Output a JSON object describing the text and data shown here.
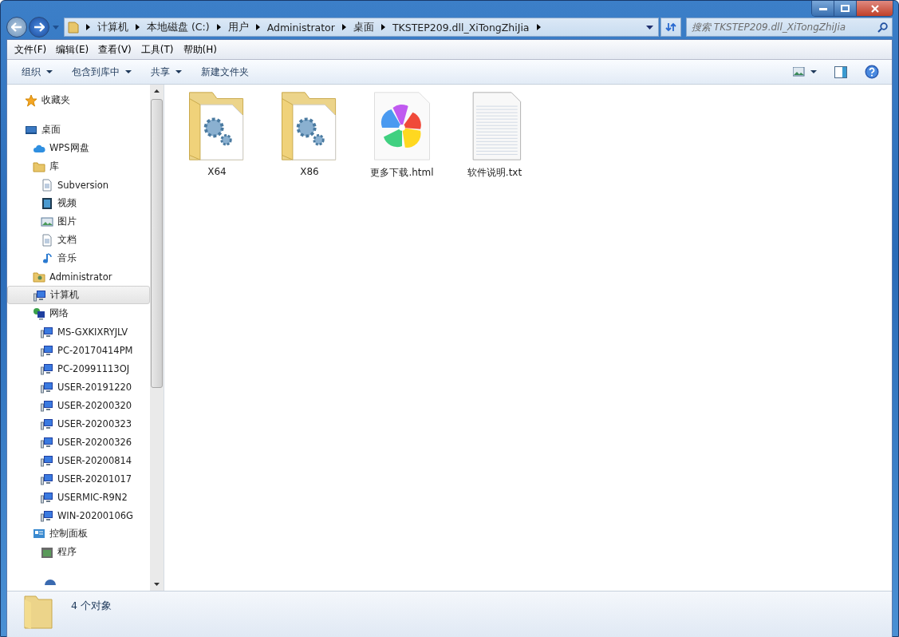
{
  "address_bar": {
    "segments": [
      "计算机",
      "本地磁盘 (C:)",
      "用户",
      "Administrator",
      "桌面",
      "TKSTEP209.dll_XiTongZhiJia"
    ]
  },
  "search": {
    "placeholder": "搜索 TKSTEP209.dll_XiTongZhiJia"
  },
  "menu": [
    "文件(F)",
    "编辑(E)",
    "查看(V)",
    "工具(T)",
    "帮助(H)"
  ],
  "toolbar": [
    {
      "label": "组织",
      "dropdown": true
    },
    {
      "label": "包含到库中",
      "dropdown": true
    },
    {
      "label": "共享",
      "dropdown": true
    },
    {
      "label": "新建文件夹",
      "dropdown": false
    }
  ],
  "sidebar": {
    "groups": [
      {
        "items": [
          {
            "label": "收藏夹",
            "kind": "star",
            "selected": false
          }
        ]
      },
      {
        "items": [
          {
            "label": "桌面",
            "kind": "desktop",
            "selected": false,
            "children": [
              {
                "label": "WPS网盘",
                "kind": "cloud",
                "selected": false
              },
              {
                "label": "库",
                "kind": "library",
                "selected": false,
                "children": [
                  {
                    "label": "Subversion",
                    "kind": "svn",
                    "selected": false
                  },
                  {
                    "label": "视频",
                    "kind": "video",
                    "selected": false
                  },
                  {
                    "label": "图片",
                    "kind": "picture",
                    "selected": false
                  },
                  {
                    "label": "文档",
                    "kind": "document",
                    "selected": false
                  },
                  {
                    "label": "音乐",
                    "kind": "music",
                    "selected": false
                  }
                ]
              },
              {
                "label": "Administrator",
                "kind": "user",
                "selected": false
              },
              {
                "label": "计算机",
                "kind": "computer",
                "selected": true
              },
              {
                "label": "网络",
                "kind": "network",
                "selected": false,
                "children": [
                  {
                    "label": "MS-GXKIXRYJLV",
                    "kind": "computer",
                    "selected": false
                  },
                  {
                    "label": "PC-20170414PM",
                    "kind": "computer",
                    "selected": false
                  },
                  {
                    "label": "PC-20991113OJ",
                    "kind": "computer",
                    "selected": false
                  },
                  {
                    "label": "USER-20191220",
                    "kind": "computer",
                    "selected": false
                  },
                  {
                    "label": "USER-20200320",
                    "kind": "computer",
                    "selected": false
                  },
                  {
                    "label": "USER-20200323",
                    "kind": "computer",
                    "selected": false
                  },
                  {
                    "label": "USER-20200326",
                    "kind": "computer",
                    "selected": false
                  },
                  {
                    "label": "USER-20200814",
                    "kind": "computer",
                    "selected": false
                  },
                  {
                    "label": "USER-20201017",
                    "kind": "computer",
                    "selected": false
                  },
                  {
                    "label": "USERMIC-R9N2",
                    "kind": "computer",
                    "selected": false
                  },
                  {
                    "label": "WIN-20200106G",
                    "kind": "computer",
                    "selected": false
                  }
                ]
              },
              {
                "label": "控制面板",
                "kind": "control-panel",
                "selected": false,
                "children": [
                  {
                    "label": "程序",
                    "kind": "program",
                    "selected": false
                  }
                ]
              }
            ]
          }
        ]
      }
    ]
  },
  "files": [
    {
      "name": "X64",
      "kind": "folder"
    },
    {
      "name": "X86",
      "kind": "folder"
    },
    {
      "name": "更多下载.html",
      "kind": "html"
    },
    {
      "name": "软件说明.txt",
      "kind": "text"
    }
  ],
  "status_bar": {
    "count": "4 个对象"
  }
}
